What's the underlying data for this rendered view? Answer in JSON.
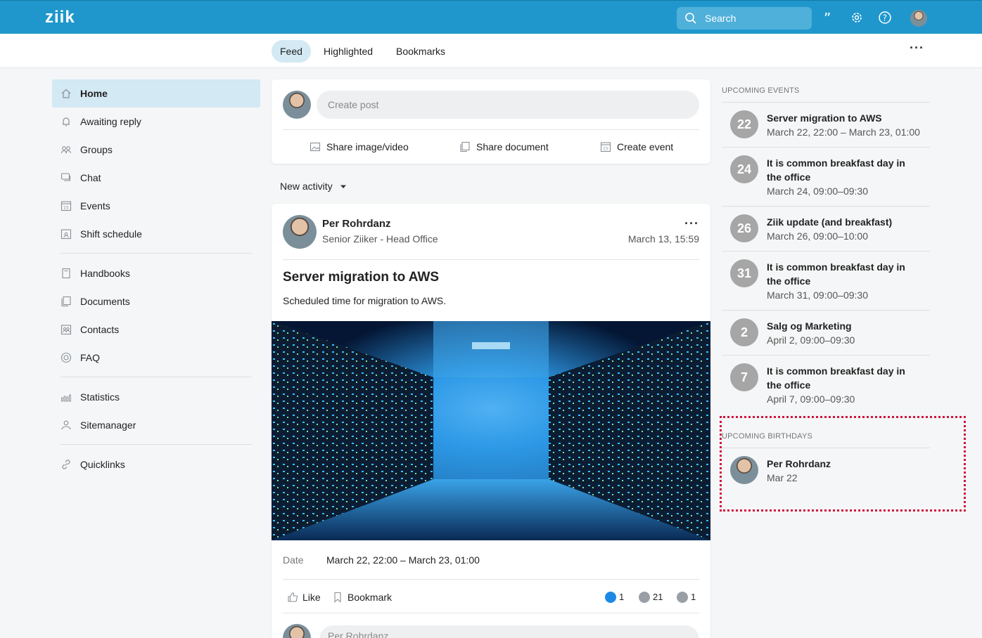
{
  "app": {
    "logo": "ziik"
  },
  "topbar": {
    "search_placeholder": "Search"
  },
  "tabs": [
    {
      "label": "Feed",
      "active": true
    },
    {
      "label": "Highlighted",
      "active": false
    },
    {
      "label": "Bookmarks",
      "active": false
    }
  ],
  "sidebar": {
    "items": [
      {
        "label": "Home",
        "icon": "home-icon",
        "active": true
      },
      {
        "label": "Awaiting reply",
        "icon": "bell-icon"
      },
      {
        "label": "Groups",
        "icon": "groups-icon"
      },
      {
        "label": "Chat",
        "icon": "chat-icon"
      },
      {
        "label": "Events",
        "icon": "calendar-icon"
      },
      {
        "label": "Shift schedule",
        "icon": "shift-icon"
      },
      {
        "label": "Handbooks",
        "icon": "book-icon"
      },
      {
        "label": "Documents",
        "icon": "documents-icon"
      },
      {
        "label": "Contacts",
        "icon": "contacts-icon"
      },
      {
        "label": "FAQ",
        "icon": "lifebuoy-icon"
      },
      {
        "label": "Statistics",
        "icon": "statistics-icon"
      },
      {
        "label": "Sitemanager",
        "icon": "sitemanager-icon"
      },
      {
        "label": "Quicklinks",
        "icon": "link-icon"
      }
    ]
  },
  "composer": {
    "placeholder": "Create post",
    "actions": [
      "Share image/video",
      "Share document",
      "Create event"
    ]
  },
  "filter": {
    "label": "New activity"
  },
  "post": {
    "author": "Per Rohrdanz",
    "subtitle": "Senior Ziiker - Head Office",
    "timestamp": "March 13, 15:59",
    "title": "Server migration to AWS",
    "text": "Scheduled time for migration to AWS.",
    "date_label": "Date",
    "date_value": "March 22, 22:00 – March 23, 01:00",
    "like_label": "Like",
    "bookmark_label": "Bookmark",
    "likes": "1",
    "views": "21",
    "comments": "1",
    "comment_author": "Per Rohrdanz"
  },
  "upcoming_events": {
    "heading": "UPCOMING EVENTS",
    "items": [
      {
        "day": "22",
        "title": "Server migration to AWS",
        "time": "March 22, 22:00 – March 23, 01:00"
      },
      {
        "day": "24",
        "title": "It is common breakfast day in the office",
        "time": "March 24, 09:00–09:30"
      },
      {
        "day": "26",
        "title": "Ziik update (and breakfast)",
        "time": "March 26, 09:00–10:00"
      },
      {
        "day": "31",
        "title": "It is common breakfast day in the office",
        "time": "March 31, 09:00–09:30"
      },
      {
        "day": "2",
        "title": "Salg og Marketing",
        "time": "April 2, 09:00–09:30"
      },
      {
        "day": "7",
        "title": "It is common breakfast day in the office",
        "time": "April 7, 09:00–09:30"
      }
    ]
  },
  "upcoming_birthdays": {
    "heading": "UPCOMING BIRTHDAYS",
    "items": [
      {
        "name": "Per Rohrdanz",
        "date": "Mar 22"
      }
    ]
  },
  "colors": {
    "topbar": "#1f97cc",
    "active_bg": "#d3e9f4",
    "highlight": "#d0153c",
    "like_blue": "#1e88e5"
  }
}
